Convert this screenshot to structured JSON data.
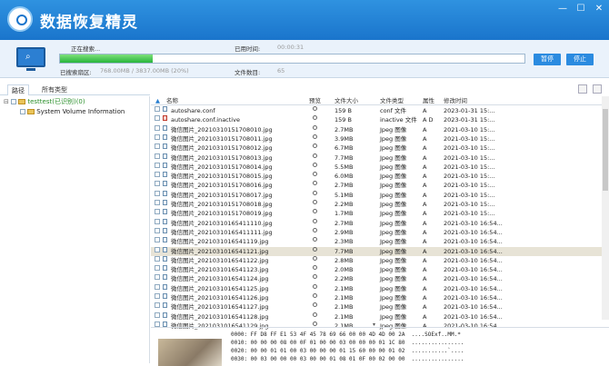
{
  "app": {
    "title": "数据恢复精灵"
  },
  "status": {
    "searching_label": "正在搜索...",
    "elapsed_label": "已用时间:",
    "elapsed_value": "00:00:31",
    "searched_label": "已搜索扇区:",
    "searched_value": "768.00MB / 3837.00MB (20%)",
    "files_label": "文件数目:",
    "files_value": "65",
    "progress_fraction": 0.2,
    "pause_label": "暂停",
    "stop_label": "停止"
  },
  "tabs": {
    "path": "路径",
    "types": "所有类型"
  },
  "tree": {
    "root": "testtest(已识别)(0)",
    "child": "System Volume Information"
  },
  "columns": {
    "name": "名称",
    "preview": "预览",
    "size": "文件大小",
    "type": "文件类型",
    "attr": "属性",
    "modified": "修改时间"
  },
  "files": [
    {
      "name": "autoshare.conf",
      "size": "159 B",
      "type": "conf 文件",
      "attr": "A",
      "modified": "2023-01-31 15:..."
    },
    {
      "name": "autoshare.conf.inactive",
      "size": "159 B",
      "type": "inactive 文件",
      "attr": "A D",
      "modified": "2023-01-31 15:..."
    },
    {
      "name": "微信图片_20210310151708010.jpg",
      "size": "2.7MB",
      "type": "Jpeg 图像",
      "attr": "A",
      "modified": "2021-03-10 15:..."
    },
    {
      "name": "微信图片_20210310151708011.jpg",
      "size": "3.9MB",
      "type": "Jpeg 图像",
      "attr": "A",
      "modified": "2021-03-10 15:..."
    },
    {
      "name": "微信图片_20210310151708012.jpg",
      "size": "6.7MB",
      "type": "Jpeg 图像",
      "attr": "A",
      "modified": "2021-03-10 15:..."
    },
    {
      "name": "微信图片_20210310151708013.jpg",
      "size": "7.7MB",
      "type": "Jpeg 图像",
      "attr": "A",
      "modified": "2021-03-10 15:..."
    },
    {
      "name": "微信图片_20210310151708014.jpg",
      "size": "5.5MB",
      "type": "Jpeg 图像",
      "attr": "A",
      "modified": "2021-03-10 15:..."
    },
    {
      "name": "微信图片_20210310151708015.jpg",
      "size": "6.0MB",
      "type": "Jpeg 图像",
      "attr": "A",
      "modified": "2021-03-10 15:..."
    },
    {
      "name": "微信图片_20210310151708016.jpg",
      "size": "2.7MB",
      "type": "Jpeg 图像",
      "attr": "A",
      "modified": "2021-03-10 15:..."
    },
    {
      "name": "微信图片_20210310151708017.jpg",
      "size": "5.1MB",
      "type": "Jpeg 图像",
      "attr": "A",
      "modified": "2021-03-10 15:..."
    },
    {
      "name": "微信图片_20210310151708018.jpg",
      "size": "2.2MB",
      "type": "Jpeg 图像",
      "attr": "A",
      "modified": "2021-03-10 15:..."
    },
    {
      "name": "微信图片_20210310151708019.jpg",
      "size": "1.7MB",
      "type": "Jpeg 图像",
      "attr": "A",
      "modified": "2021-03-10 15:..."
    },
    {
      "name": "微信图片_20210310165411110.jpg",
      "size": "2.7MB",
      "type": "Jpeg 图像",
      "attr": "A",
      "modified": "2021-03-10 16:54..."
    },
    {
      "name": "微信图片_20210310165411111.jpg",
      "size": "2.9MB",
      "type": "Jpeg 图像",
      "attr": "A",
      "modified": "2021-03-10 16:54..."
    },
    {
      "name": "微信图片_2021031016541119.jpg",
      "size": "2.3MB",
      "type": "Jpeg 图像",
      "attr": "A",
      "modified": "2021-03-10 16:54..."
    },
    {
      "name": "微信图片_2021031016541121.jpg",
      "size": "7.7MB",
      "type": "Jpeg 图像",
      "attr": "A",
      "modified": "2021-03-10 16:54..."
    },
    {
      "name": "微信图片_2021031016541122.jpg",
      "size": "2.8MB",
      "type": "Jpeg 图像",
      "attr": "A",
      "modified": "2021-03-10 16:54..."
    },
    {
      "name": "微信图片_2021031016541123.jpg",
      "size": "2.0MB",
      "type": "Jpeg 图像",
      "attr": "A",
      "modified": "2021-03-10 16:54..."
    },
    {
      "name": "微信图片_2021031016541124.jpg",
      "size": "2.2MB",
      "type": "Jpeg 图像",
      "attr": "A",
      "modified": "2021-03-10 16:54..."
    },
    {
      "name": "微信图片_2021031016541125.jpg",
      "size": "2.1MB",
      "type": "Jpeg 图像",
      "attr": "A",
      "modified": "2021-03-10 16:54..."
    },
    {
      "name": "微信图片_2021031016541126.jpg",
      "size": "2.1MB",
      "type": "Jpeg 图像",
      "attr": "A",
      "modified": "2021-03-10 16:54..."
    },
    {
      "name": "微信图片_2021031016541127.jpg",
      "size": "2.1MB",
      "type": "Jpeg 图像",
      "attr": "A",
      "modified": "2021-03-10 16:54..."
    },
    {
      "name": "微信图片_2021031016541128.jpg",
      "size": "2.1MB",
      "type": "Jpeg 图像",
      "attr": "A",
      "modified": "2021-03-10 16:54..."
    },
    {
      "name": "微信图片_2021031016541129.jpg",
      "size": "2.1MB",
      "type": "Jpeg 图像",
      "attr": "A",
      "modified": "2021-03-10 16:54..."
    }
  ],
  "selected_index": 15,
  "hex": [
    "0000: FF D8 FF E1 53 4F 45 78 69 66 00 00 4D 4D 00 2A  ....SOExf..MM.*",
    "0010: 00 00 00 08 00 0F 01 00 00 03 00 00 00 01 1C 80  ................",
    "0020: 00 00 01 01 00 03 00 00 00 01 15 60 00 00 01 02  ...........`....",
    "0030: 00 03 00 00 00 03 00 00 01 08 01 0F 00 02 00 00  ................"
  ]
}
